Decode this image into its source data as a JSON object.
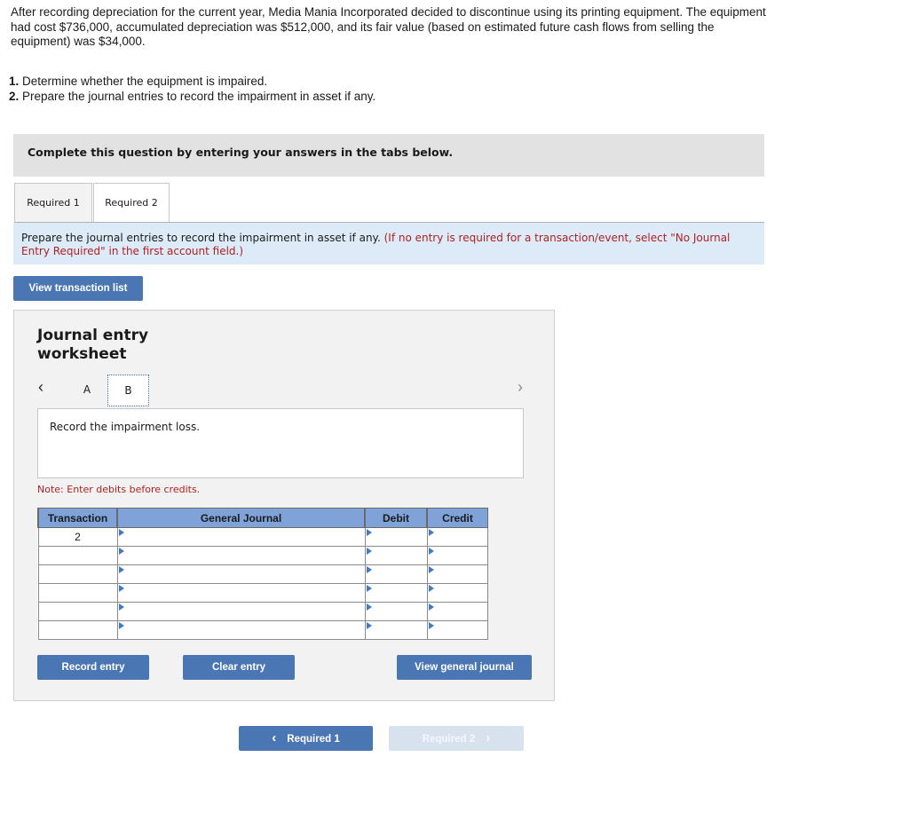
{
  "problem": {
    "intro": "After recording depreciation for the current year, Media Mania Incorporated decided to discontinue using its printing equipment. The equipment had cost $736,000, accumulated depreciation was $512,000, and its fair value (based on estimated future cash flows from selling the equipment) was $34,000.",
    "requirements": [
      {
        "num": "1.",
        "text": "Determine whether the equipment is impaired."
      },
      {
        "num": "2.",
        "text": "Prepare the journal entries to record the impairment in asset if any."
      }
    ]
  },
  "banner": {
    "text": "Complete this question by entering your answers in the tabs below."
  },
  "tabs": [
    {
      "label": "Required 1",
      "active": false
    },
    {
      "label": "Required 2",
      "active": true
    }
  ],
  "instructions": {
    "main": "Prepare the journal entries to record the impairment in asset if any.",
    "note": "(If no entry is required for a transaction/event, select \"No Journal Entry Required\" in the first account field.)"
  },
  "buttons": {
    "view_transaction_list": "View transaction list",
    "record_entry": "Record entry",
    "clear_entry": "Clear entry",
    "view_general_journal": "View general journal"
  },
  "worksheet": {
    "title": "Journal entry worksheet",
    "prev_icon": "‹",
    "next_icon": "›",
    "steps": [
      "A",
      "B"
    ],
    "active_step": "B",
    "description": "Record the impairment loss.",
    "note": "Note: Enter debits before credits."
  },
  "journal_table": {
    "headers": [
      "Transaction",
      "General Journal",
      "Debit",
      "Credit"
    ],
    "rows": [
      {
        "transaction": "2",
        "account": "",
        "debit": "",
        "credit": ""
      },
      {
        "transaction": "",
        "account": "",
        "debit": "",
        "credit": ""
      },
      {
        "transaction": "",
        "account": "",
        "debit": "",
        "credit": ""
      },
      {
        "transaction": "",
        "account": "",
        "debit": "",
        "credit": ""
      },
      {
        "transaction": "",
        "account": "",
        "debit": "",
        "credit": ""
      },
      {
        "transaction": "",
        "account": "",
        "debit": "",
        "credit": ""
      }
    ]
  },
  "bottom_nav": {
    "prev_label": "Required 1",
    "prev_icon": "‹",
    "next_label": "Required 2",
    "next_icon": "›",
    "next_enabled": false
  },
  "colors": {
    "button_blue": "#4a77b4",
    "header_blue": "#7fa3d9",
    "instruction_bg": "#ddebf8",
    "note_red": "#b02020",
    "disabled_button": "#d8e2ef"
  }
}
